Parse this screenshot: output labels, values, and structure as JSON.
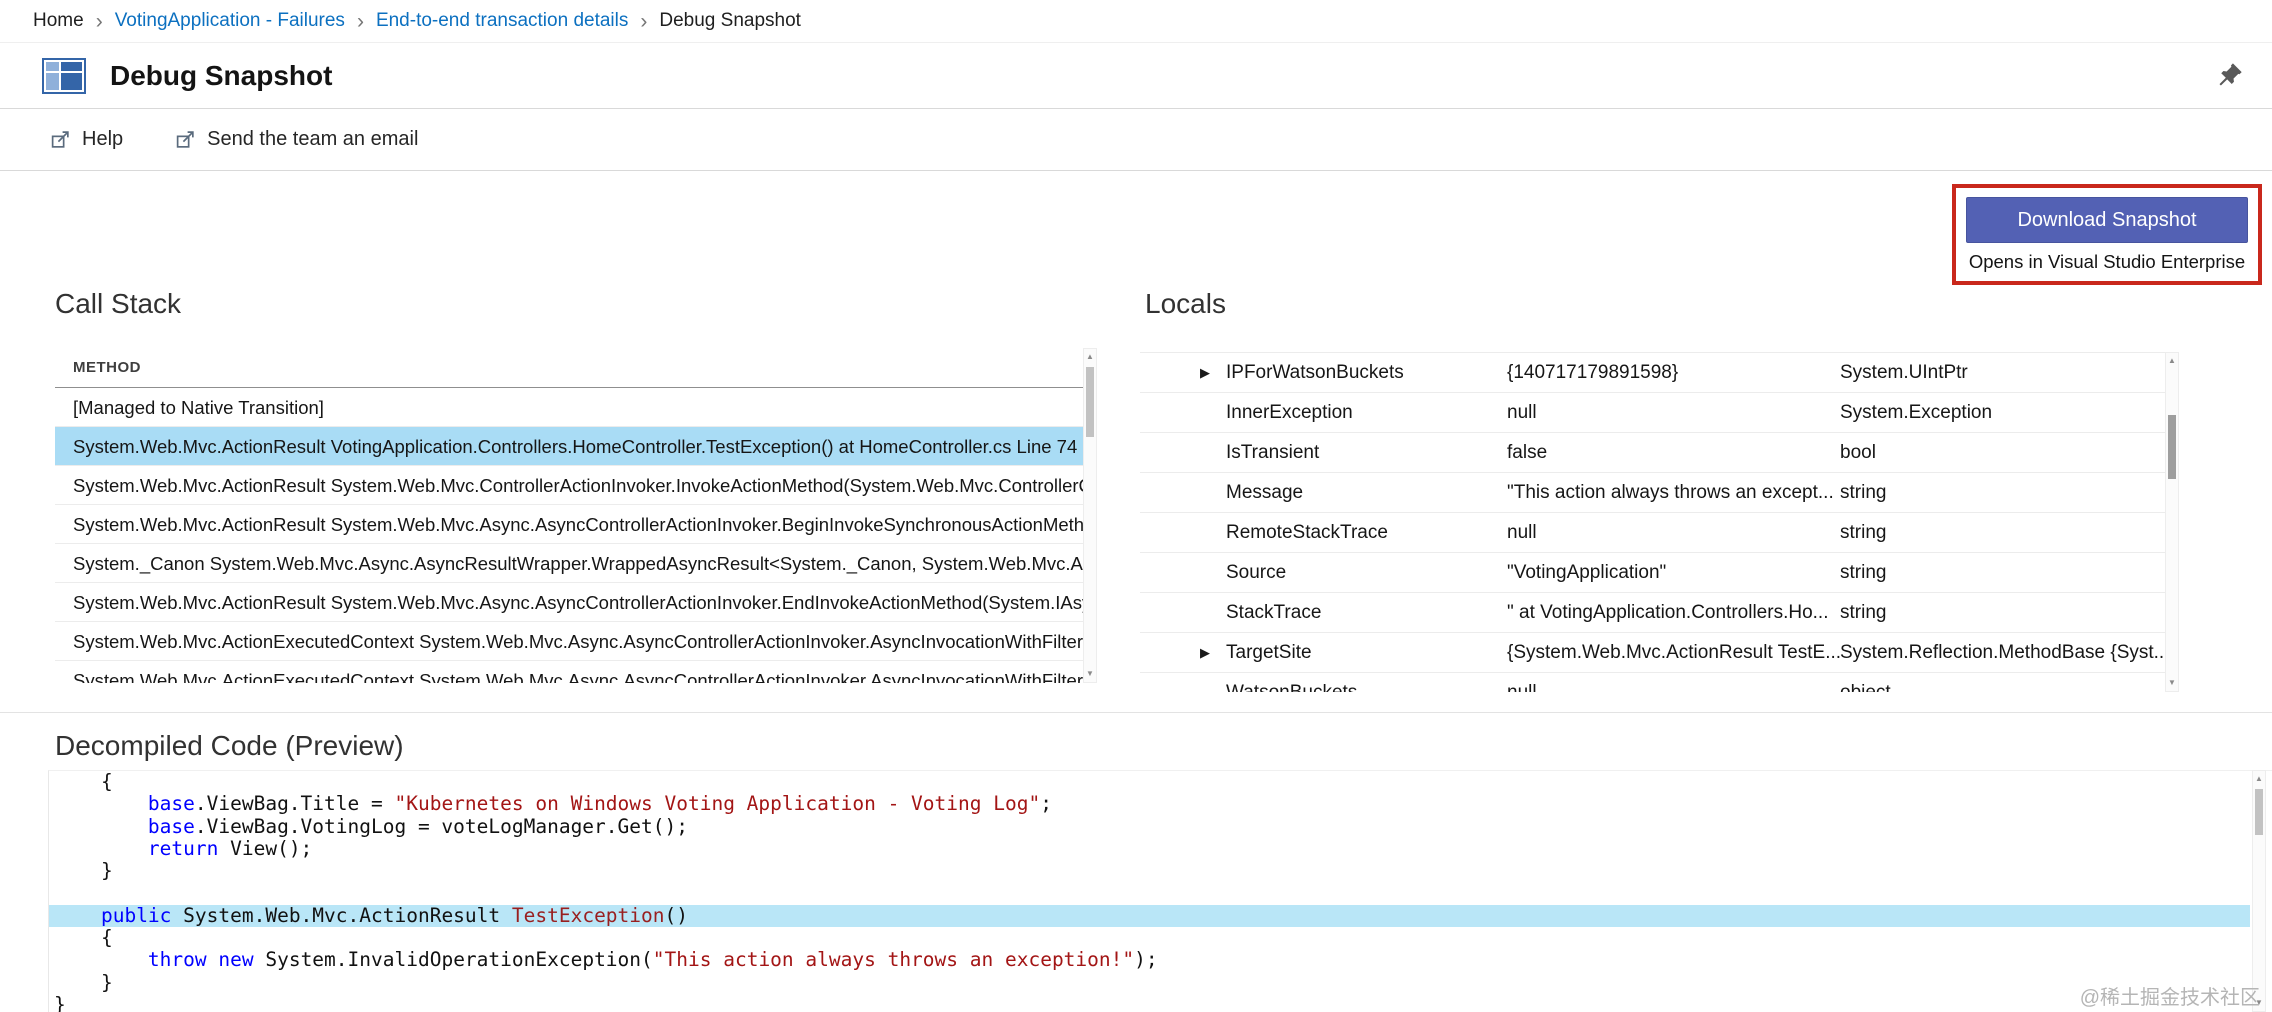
{
  "colors": {
    "link": "#0c70c0",
    "accent": "#5361b4",
    "accent_border": "#47549e",
    "red": "#c9281c",
    "row_highlight": "#a9dcf5",
    "code_highlight": "#b9e6f7",
    "keyword": "#0000ff",
    "string": "#a31515",
    "method": "#991f1f"
  },
  "breadcrumb": {
    "separator": "›",
    "items": [
      {
        "label": "Home",
        "link": false
      },
      {
        "label": "VotingApplication - Failures",
        "link": true
      },
      {
        "label": "End-to-end transaction details",
        "link": true
      },
      {
        "label": "Debug Snapshot",
        "link": false
      }
    ]
  },
  "header": {
    "title": "Debug Snapshot"
  },
  "toolbar": {
    "help_label": "Help",
    "email_label": "Send the team an email"
  },
  "download": {
    "button_label": "Download Snapshot",
    "subtext": "Opens in Visual Studio Enterprise"
  },
  "call_stack": {
    "title": "Call Stack",
    "column_header": "METHOD",
    "rows": [
      {
        "highlighted": false,
        "text": "[Managed to Native Transition]"
      },
      {
        "highlighted": true,
        "text": "System.Web.Mvc.ActionResult VotingApplication.Controllers.HomeController.TestException() at HomeController.cs Line 74"
      },
      {
        "highlighted": false,
        "text": "System.Web.Mvc.ActionResult System.Web.Mvc.ControllerActionInvoker.InvokeActionMethod(System.Web.Mvc.ControllerC..."
      },
      {
        "highlighted": false,
        "text": "System.Web.Mvc.ActionResult System.Web.Mvc.Async.AsyncControllerActionInvoker.BeginInvokeSynchronousActionMetho..."
      },
      {
        "highlighted": false,
        "text": "System._Canon System.Web.Mvc.Async.AsyncResultWrapper.WrappedAsyncResult<System._Canon, System.Web.Mvc.Asy..."
      },
      {
        "highlighted": false,
        "text": "System.Web.Mvc.ActionResult System.Web.Mvc.Async.AsyncControllerActionInvoker.EndInvokeActionMethod(System.IAsyn..."
      },
      {
        "highlighted": false,
        "text": "System.Web.Mvc.ActionExecutedContext System.Web.Mvc.Async.AsyncControllerActionInvoker.AsyncInvocationWithFilters...."
      },
      {
        "highlighted": false,
        "text": "System.Web.Mvc.ActionExecutedContext System.Web.Mvc.Async.AsyncControllerActionInvoker.AsyncInvocationWithFilters...."
      }
    ]
  },
  "locals": {
    "title": "Locals",
    "rows": [
      {
        "expandable": true,
        "name": "IPForWatsonBuckets",
        "value": "{140717179891598}",
        "type": "System.UIntPtr"
      },
      {
        "expandable": false,
        "name": "InnerException",
        "value": "null",
        "type": "System.Exception"
      },
      {
        "expandable": false,
        "name": "IsTransient",
        "value": "false",
        "type": "bool"
      },
      {
        "expandable": false,
        "name": "Message",
        "value": "\"This action always throws an except...",
        "type": "string"
      },
      {
        "expandable": false,
        "name": "RemoteStackTrace",
        "value": "null",
        "type": "string"
      },
      {
        "expandable": false,
        "name": "Source",
        "value": "\"VotingApplication\"",
        "type": "string"
      },
      {
        "expandable": false,
        "name": "StackTrace",
        "value": "\" at VotingApplication.Controllers.Ho...",
        "type": "string"
      },
      {
        "expandable": true,
        "name": "TargetSite",
        "value": "{System.Web.Mvc.ActionResult TestE...",
        "type": "System.Reflection.MethodBase {Syst..."
      },
      {
        "expandable": false,
        "name": "WatsonBuckets",
        "value": "null",
        "type": "object"
      }
    ]
  },
  "code": {
    "title": "Decompiled Code (Preview)",
    "lines": [
      {
        "hl": false,
        "tokens": [
          {
            "c": "p",
            "t": "    {"
          }
        ]
      },
      {
        "hl": false,
        "tokens": [
          {
            "c": "p",
            "t": "        "
          },
          {
            "c": "k",
            "t": "base"
          },
          {
            "c": "p",
            "t": ".ViewBag.Title = "
          },
          {
            "c": "s",
            "t": "\"Kubernetes on Windows Voting Application - Voting Log\""
          },
          {
            "c": "p",
            "t": ";"
          }
        ]
      },
      {
        "hl": false,
        "tokens": [
          {
            "c": "p",
            "t": "        "
          },
          {
            "c": "k",
            "t": "base"
          },
          {
            "c": "p",
            "t": ".ViewBag.VotingLog = voteLogManager.Get();"
          }
        ]
      },
      {
        "hl": false,
        "tokens": [
          {
            "c": "p",
            "t": "        "
          },
          {
            "c": "k",
            "t": "return"
          },
          {
            "c": "p",
            "t": " View();"
          }
        ]
      },
      {
        "hl": false,
        "tokens": [
          {
            "c": "p",
            "t": "    }"
          }
        ]
      },
      {
        "hl": false,
        "tokens": [
          {
            "c": "p",
            "t": " "
          }
        ]
      },
      {
        "hl": true,
        "tokens": [
          {
            "c": "p",
            "t": "    "
          },
          {
            "c": "k",
            "t": "public"
          },
          {
            "c": "p",
            "t": " System.Web.Mvc.ActionResult "
          },
          {
            "c": "m",
            "t": "TestException"
          },
          {
            "c": "p",
            "t": "()"
          }
        ]
      },
      {
        "hl": false,
        "tokens": [
          {
            "c": "p",
            "t": "    {"
          }
        ]
      },
      {
        "hl": false,
        "tokens": [
          {
            "c": "p",
            "t": "        "
          },
          {
            "c": "k",
            "t": "throw"
          },
          {
            "c": "p",
            "t": " "
          },
          {
            "c": "k",
            "t": "new"
          },
          {
            "c": "p",
            "t": " System.InvalidOperationException("
          },
          {
            "c": "s",
            "t": "\"This action always throws an exception!\""
          },
          {
            "c": "p",
            "t": ");"
          }
        ]
      },
      {
        "hl": false,
        "tokens": [
          {
            "c": "p",
            "t": "    }"
          }
        ]
      },
      {
        "hl": false,
        "tokens": [
          {
            "c": "p",
            "t": "}"
          }
        ]
      }
    ]
  },
  "watermark": "@稀土掘金技术社区"
}
